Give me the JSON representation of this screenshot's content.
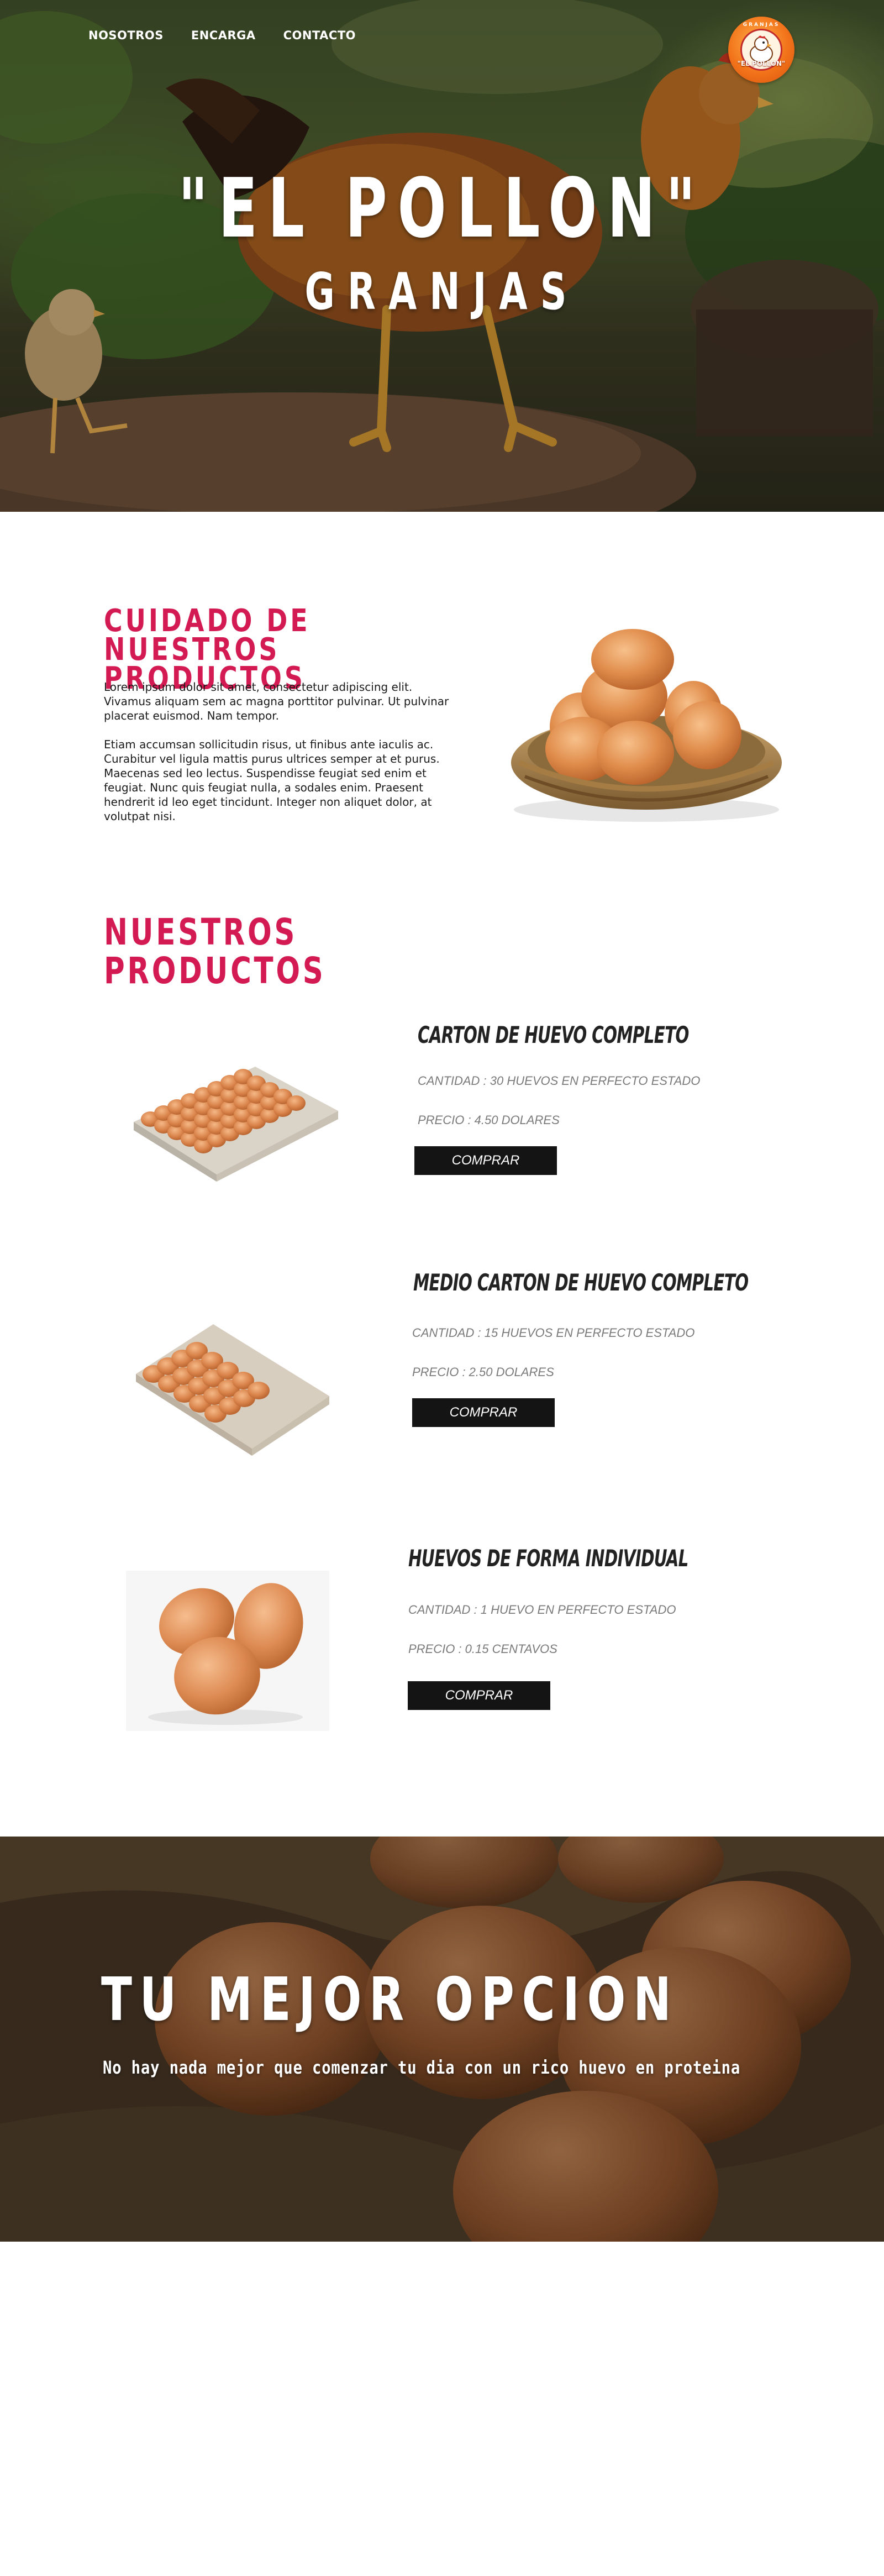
{
  "nav": {
    "items": [
      {
        "label": "NOSOTROS"
      },
      {
        "label": "ENCARGA"
      },
      {
        "label": "CONTACTO"
      }
    ]
  },
  "logo": {
    "top_text": "GRANJAS",
    "text": "\"EL POLLON\""
  },
  "hero": {
    "title": "\"EL POLLON\"",
    "subtitle": "GRANJAS"
  },
  "about": {
    "heading": "CUIDADO DE NUESTROS PRODUCTOS",
    "paragraph1": "Lorem ipsum dolor sit amet, consectetur adipiscing elit. Vivamus aliquam sem ac magna porttitor pulvinar. Ut pulvinar placerat euismod. Nam tempor.",
    "paragraph2": "Etiam accumsan sollicitudin risus, ut finibus ante iaculis ac. Curabitur vel ligula mattis purus ultrices semper at et purus. Maecenas sed leo lectus. Suspendisse feugiat sed enim et feugiat. Nunc quis feugiat nulla, a sodales enim. Praesent hendrerit id leo eget tincidunt. Integer non aliquet dolor, at volutpat nisi."
  },
  "products": {
    "heading": "NUESTROS PRODUCTOS",
    "items": [
      {
        "title": "CARTON DE HUEVO COMPLETO",
        "quantity": "CANTIDAD : 30 HUEVOS EN PERFECTO ESTADO",
        "price": "PRECIO : 4.50 DOLARES",
        "button": "COMPRAR"
      },
      {
        "title": "MEDIO CARTON DE HUEVO COMPLETO",
        "quantity": "CANTIDAD : 15 HUEVOS EN PERFECTO ESTADO",
        "price": "PRECIO : 2.50 DOLARES",
        "button": "COMPRAR"
      },
      {
        "title": "HUEVOS DE FORMA INDIVIDUAL",
        "quantity": "CANTIDAD : 1 HUEVO EN PERFECTO ESTADO",
        "price": "PRECIO : 0.15 CENTAVOS",
        "button": "COMPRAR"
      }
    ]
  },
  "cta": {
    "title": "TU MEJOR OPCION",
    "text": "No hay nada mejor que comenzar tu dia con un rico huevo en proteina"
  },
  "colors": {
    "accent": "#d41a52",
    "button": "#141414",
    "logo_orange": "#f2731a"
  }
}
